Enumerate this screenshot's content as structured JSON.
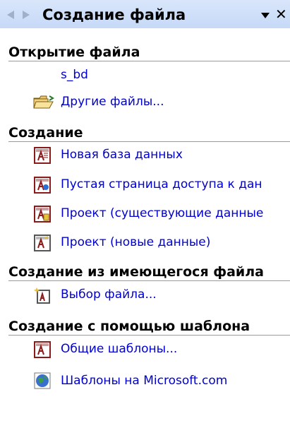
{
  "taskpane": {
    "title": "Создание файла",
    "back_icon": "back-arrow-icon",
    "forward_icon": "forward-arrow-icon",
    "menu_icon": "dropdown-arrow-icon",
    "close_label": "✕"
  },
  "open_section": {
    "header": "Открытие файла",
    "recent": "s_bd",
    "other_files": "Другие файлы..."
  },
  "create_section": {
    "header": "Создание",
    "items": [
      {
        "label": "Новая база данных",
        "icon": "access-db-icon"
      },
      {
        "label": "Пустая страница доступа к дан",
        "icon": "data-access-page-icon"
      },
      {
        "label": "Проект (существующие данные",
        "icon": "project-existing-data-icon"
      },
      {
        "label": "Проект (новые данные)",
        "icon": "project-new-data-icon"
      }
    ]
  },
  "from_existing_section": {
    "header": "Создание из имеющегося файла",
    "item": {
      "label": "Выбор файла...",
      "icon": "new-from-existing-icon"
    }
  },
  "template_section": {
    "header": "Создание с помощью шаблона",
    "items": [
      {
        "label": "Общие шаблоны...",
        "icon": "templates-icon"
      },
      {
        "label": "Шаблоны на Microsoft.com",
        "icon": "globe-icon"
      }
    ]
  },
  "colors": {
    "link": "#0000d0",
    "titlebar": "#c6d9f7"
  }
}
